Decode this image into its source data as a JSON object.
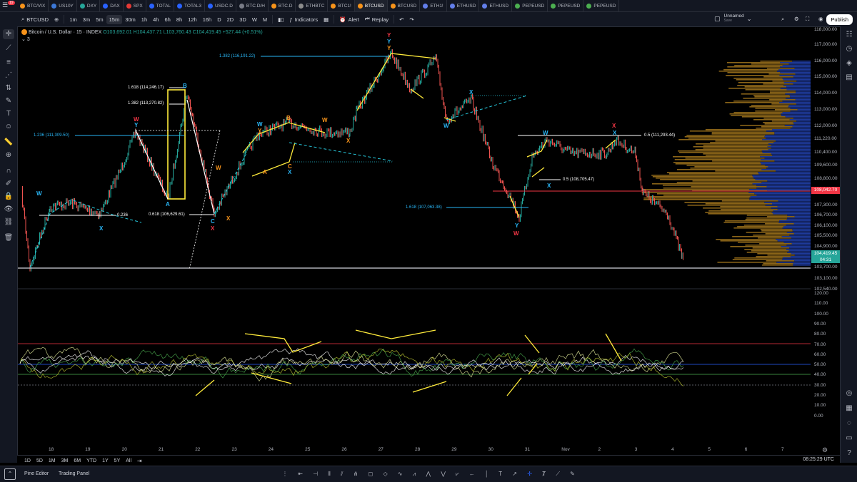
{
  "tabs": [
    {
      "label": "BTC/VIX",
      "color": "#f7931a"
    },
    {
      "label": "US10Y",
      "color": "#3c78d8"
    },
    {
      "label": "DXY",
      "color": "#26a69a"
    },
    {
      "label": "DAX",
      "color": "#2962ff"
    },
    {
      "label": "SPX",
      "color": "#e53935"
    },
    {
      "label": "TOTAL",
      "color": "#2962ff"
    },
    {
      "label": "TOTAL3",
      "color": "#2962ff"
    },
    {
      "label": "USDC.D",
      "color": "#2962ff"
    },
    {
      "label": "BTC.D/H",
      "color": "#787b86"
    },
    {
      "label": "BTC.D",
      "color": "#f7931a"
    },
    {
      "label": "ETHBTC",
      "color": "#8c8c8c"
    },
    {
      "label": "BTC1!",
      "color": "#f7931a"
    },
    {
      "label": "BTCUSD",
      "color": "#f7931a",
      "active": true
    },
    {
      "label": "BTCUSD",
      "color": "#f7931a"
    },
    {
      "label": "ETH1!",
      "color": "#627eea"
    },
    {
      "label": "ETHUSD",
      "color": "#627eea"
    },
    {
      "label": "ETHUSD",
      "color": "#627eea"
    },
    {
      "label": "PEPEUSD",
      "color": "#4caf50"
    },
    {
      "label": "PEPEUSD",
      "color": "#4caf50"
    },
    {
      "label": "PEPEUSD",
      "color": "#4caf50"
    }
  ],
  "notification_count": "19",
  "toolbar": {
    "symbol": "BTCUSD",
    "intervals": [
      "1m",
      "3m",
      "5m",
      "15m",
      "30m",
      "1h",
      "4h",
      "6h",
      "8h",
      "12h",
      "16h",
      "D",
      "2D",
      "3D",
      "W",
      "M"
    ],
    "active_interval": "15m",
    "indicators": "Indicators",
    "alert": "Alert",
    "replay": "Replay",
    "layout_name": "Unnamed",
    "layout_status": "Save",
    "publish": "Publish"
  },
  "legend": {
    "title": "Bitcoin / U.S. Dollar · 15 · INDEX",
    "o": "O103,692.01",
    "h": "H104,437.71",
    "l": "L103,760.43",
    "c": "C104,419.45",
    "chg": "+527.44 (+0.51%)",
    "count": "3"
  },
  "price_axis": [
    "118,000.00",
    "117,000.00",
    "116,000.00",
    "115,000.00",
    "114,000.00",
    "113,000.00",
    "112,000.00",
    "111,220.00",
    "110,400.00",
    "109,600.00",
    "108,800.00",
    "107,300.00",
    "106,700.00",
    "106,100.00",
    "105,500.00",
    "104,900.00",
    "103,700.00",
    "103,100.00",
    "102,540.00"
  ],
  "price_tags": {
    "red": "108,042.70",
    "current": "104,419.45",
    "countdown": "04:31"
  },
  "osc_axis": [
    "120.00",
    "110.00",
    "100.00",
    "90.00",
    "80.00",
    "70.00",
    "60.00",
    "50.00",
    "40.00",
    "30.00",
    "20.00",
    "10.00",
    "0.00"
  ],
  "time_axis": [
    "18",
    "19",
    "20",
    "21",
    "22",
    "23",
    "24",
    "25",
    "26",
    "27",
    "28",
    "29",
    "30",
    "31",
    "Nov",
    "2",
    "3",
    "4",
    "5",
    "6",
    "7"
  ],
  "fib_labels": [
    {
      "text": "1.382 (116,191.22)",
      "color": "#29b6f6"
    },
    {
      "text": "1.618 (114,246.17)",
      "color": "#ffffff"
    },
    {
      "text": "1.382 (113,270.82)",
      "color": "#ffffff"
    },
    {
      "text": "1.236 (111,309.50)",
      "color": "#29b6f6"
    },
    {
      "text": "0.236",
      "color": "#ffffff"
    },
    {
      "text": "0.618 (106,629.61)",
      "color": "#ffffff"
    },
    {
      "text": "0.5 (111,293.44)",
      "color": "#ffffff"
    },
    {
      "text": "0.5 (108,705.47)",
      "color": "#ffffff"
    },
    {
      "text": "1.618 (107,063.38)",
      "color": "#29b6f6"
    }
  ],
  "range_buttons": [
    "1D",
    "5D",
    "1M",
    "3M",
    "6M",
    "YTD",
    "1Y",
    "5Y",
    "All"
  ],
  "clock": "08:25:29 UTC",
  "panel_tabs": [
    "Pine Editor",
    "Trading Panel"
  ]
}
